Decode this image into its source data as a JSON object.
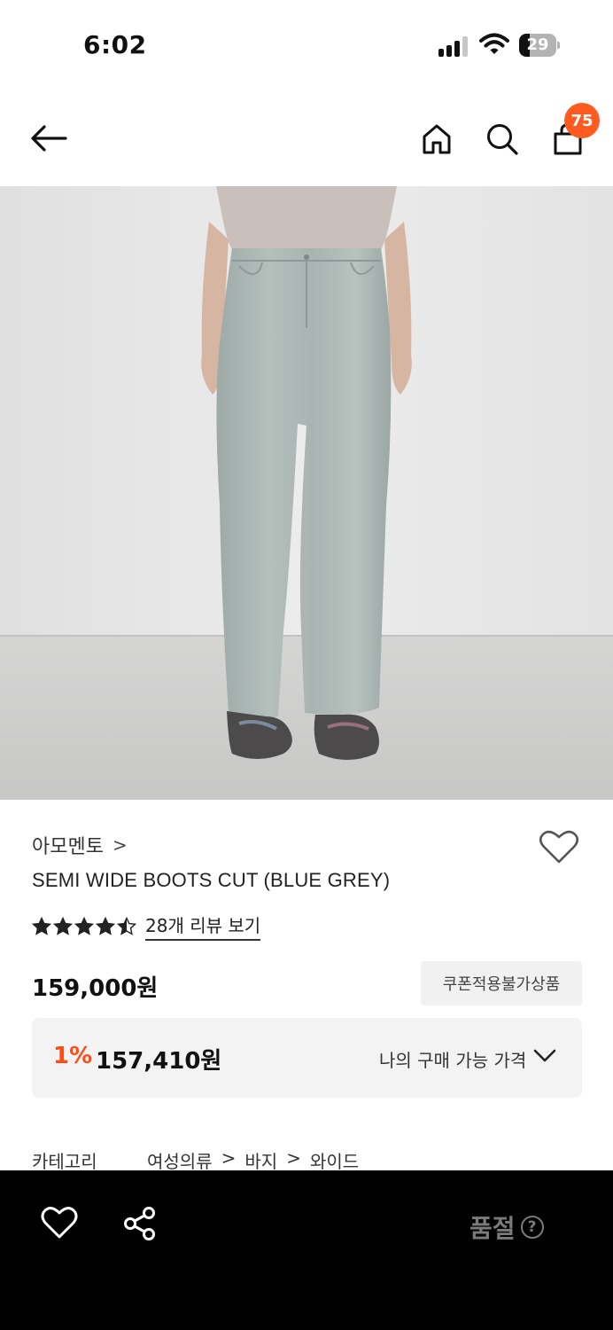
{
  "status_bar": {
    "time": "6:02",
    "battery": "29",
    "battery_level": 0.29,
    "icons": [
      "signal-icon",
      "wifi-icon",
      "battery-icon"
    ]
  },
  "header": {
    "icons": [
      "back-arrow-icon",
      "home-icon",
      "search-icon",
      "shopping-bag-icon"
    ],
    "cart_count": "75"
  },
  "product": {
    "brand": "아모멘토",
    "brand_chevron": ">",
    "name": "SEMI WIDE BOOTS CUT (BLUE GREY)",
    "rating": 4.5,
    "review_link": "28개 리뷰 보기",
    "price": "159,000원",
    "coupon_badge": "쿠폰적용불가상품",
    "discount_rate": "1%",
    "discount_price": "157,410원",
    "my_price_label": "나의 구매 가능 가격",
    "category_label": "카테고리",
    "category_path": [
      "여성의류",
      ">",
      "바지",
      ">",
      "와이드"
    ]
  },
  "bottom_bar": {
    "icons": [
      "heart-icon",
      "share-icon",
      "help-icon"
    ],
    "sold_out_label": "품절",
    "help_symbol": "?"
  },
  "colors": {
    "accent": "#ff5a1f",
    "discount": "#ff4c17",
    "bottom_bar": "#000000",
    "sold_out_text": "#7a7a7a"
  }
}
